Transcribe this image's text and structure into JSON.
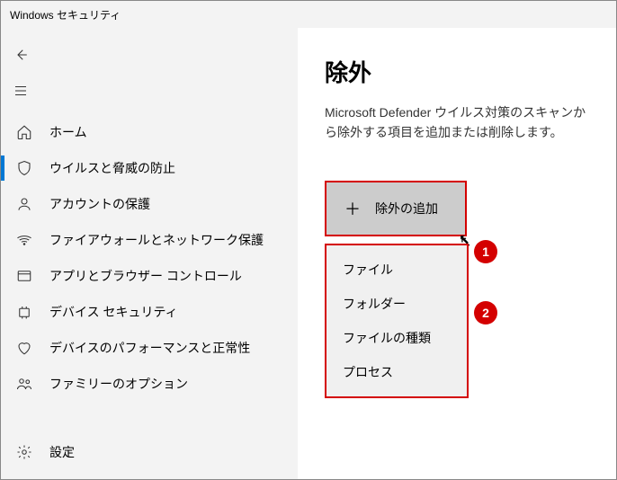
{
  "window": {
    "title": "Windows セキュリティ"
  },
  "sidebar": {
    "items": [
      {
        "label": "ホーム"
      },
      {
        "label": "ウイルスと脅威の防止"
      },
      {
        "label": "アカウントの保護"
      },
      {
        "label": "ファイアウォールとネットワーク保護"
      },
      {
        "label": "アプリとブラウザー コントロール"
      },
      {
        "label": "デバイス セキュリティ"
      },
      {
        "label": "デバイスのパフォーマンスと正常性"
      },
      {
        "label": "ファミリーのオプション"
      }
    ],
    "settings": {
      "label": "設定"
    }
  },
  "main": {
    "heading": "除外",
    "description": "Microsoft Defender ウイルス対策のスキャンから除外する項目を追加または削除します。",
    "add_button": "除外の追加",
    "menu": {
      "items": [
        {
          "label": "ファイル"
        },
        {
          "label": "フォルダー"
        },
        {
          "label": "ファイルの種類"
        },
        {
          "label": "プロセス"
        }
      ]
    }
  },
  "annotations": {
    "badge1": "1",
    "badge2": "2"
  }
}
